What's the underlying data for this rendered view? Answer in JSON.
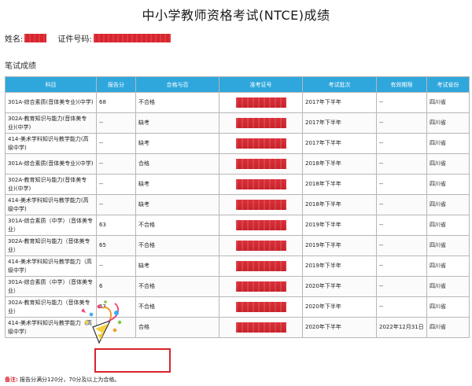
{
  "page_title": "中小学教师资格考试(NTCE)成绩",
  "info": {
    "name_label": "姓名:",
    "id_label": "证件号码:"
  },
  "section_title": "笔试成绩",
  "table": {
    "headers": [
      "科目",
      "报告分",
      "合格与否",
      "准考证号",
      "考试批次",
      "有效期限",
      "考试省份"
    ],
    "rows": [
      {
        "subject": "301A-综合素质(音体美专业)(中学)",
        "score": "68",
        "pass": "不合格",
        "batch": "2017年下半年",
        "validity": "--",
        "province": "四川省"
      },
      {
        "subject": "302A-教育知识与能力(音体美专业)(中学)",
        "score": "--",
        "pass": "缺考",
        "batch": "2017年下半年",
        "validity": "--",
        "province": "四川省"
      },
      {
        "subject": "414-美术学科知识与教学能力(高级中学)",
        "score": "--",
        "pass": "缺考",
        "batch": "2017年下半年",
        "validity": "--",
        "province": "四川省"
      },
      {
        "subject": "301A-综合素质(音体美专业)(中学)",
        "score": "--",
        "pass": "合格",
        "batch": "2018年下半年",
        "validity": "--",
        "province": "四川省"
      },
      {
        "subject": "302A-教育知识与能力(音体美专业)(中学)",
        "score": "--",
        "pass": "缺考",
        "batch": "2018年下半年",
        "validity": "--",
        "province": "四川省"
      },
      {
        "subject": "414-美术学科知识与教学能力(高级中学)",
        "score": "--",
        "pass": "缺考",
        "batch": "2018年下半年",
        "validity": "--",
        "province": "四川省"
      },
      {
        "subject": "301A-综合素质（中学）（音体美专业）",
        "score": "63",
        "pass": "不合格",
        "batch": "2019年下半年",
        "validity": "--",
        "province": "四川省"
      },
      {
        "subject": "302A-教育知识与能力（音体美专业）",
        "score": "65",
        "pass": "不合格",
        "batch": "2019年下半年",
        "validity": "--",
        "province": "四川省"
      },
      {
        "subject": "414-美术学科知识与教学能力（高级中学）",
        "score": "--",
        "pass": "缺考",
        "batch": "2019年下半年",
        "validity": "--",
        "province": "四川省"
      },
      {
        "subject": "301A-综合素质（中学）（音体美专业）",
        "score": "6",
        "pass": "不合格",
        "batch": "2020年下半年",
        "validity": "--",
        "province": "四川省"
      },
      {
        "subject": "302A-教育知识与能力（音体美专业）",
        "score": "63",
        "pass": "不合格",
        "batch": "2020年下半年",
        "validity": "--",
        "province": "四川省"
      },
      {
        "subject": "414-美术学科知识与教学能力（高级中学）",
        "score": "73",
        "pass": "合格",
        "batch": "2020年下半年",
        "validity": "2022年12月31日",
        "province": "四川省"
      }
    ]
  },
  "note": {
    "label": "备注:",
    "text": "报告分满分120分，70分及以上为合格。"
  },
  "colors": {
    "header_blue": "#2fa7dc",
    "redaction_red": "#d8252e",
    "highlight_red": "#d8252e"
  },
  "icons": {
    "sticker": "celebration-sticker-icon"
  }
}
